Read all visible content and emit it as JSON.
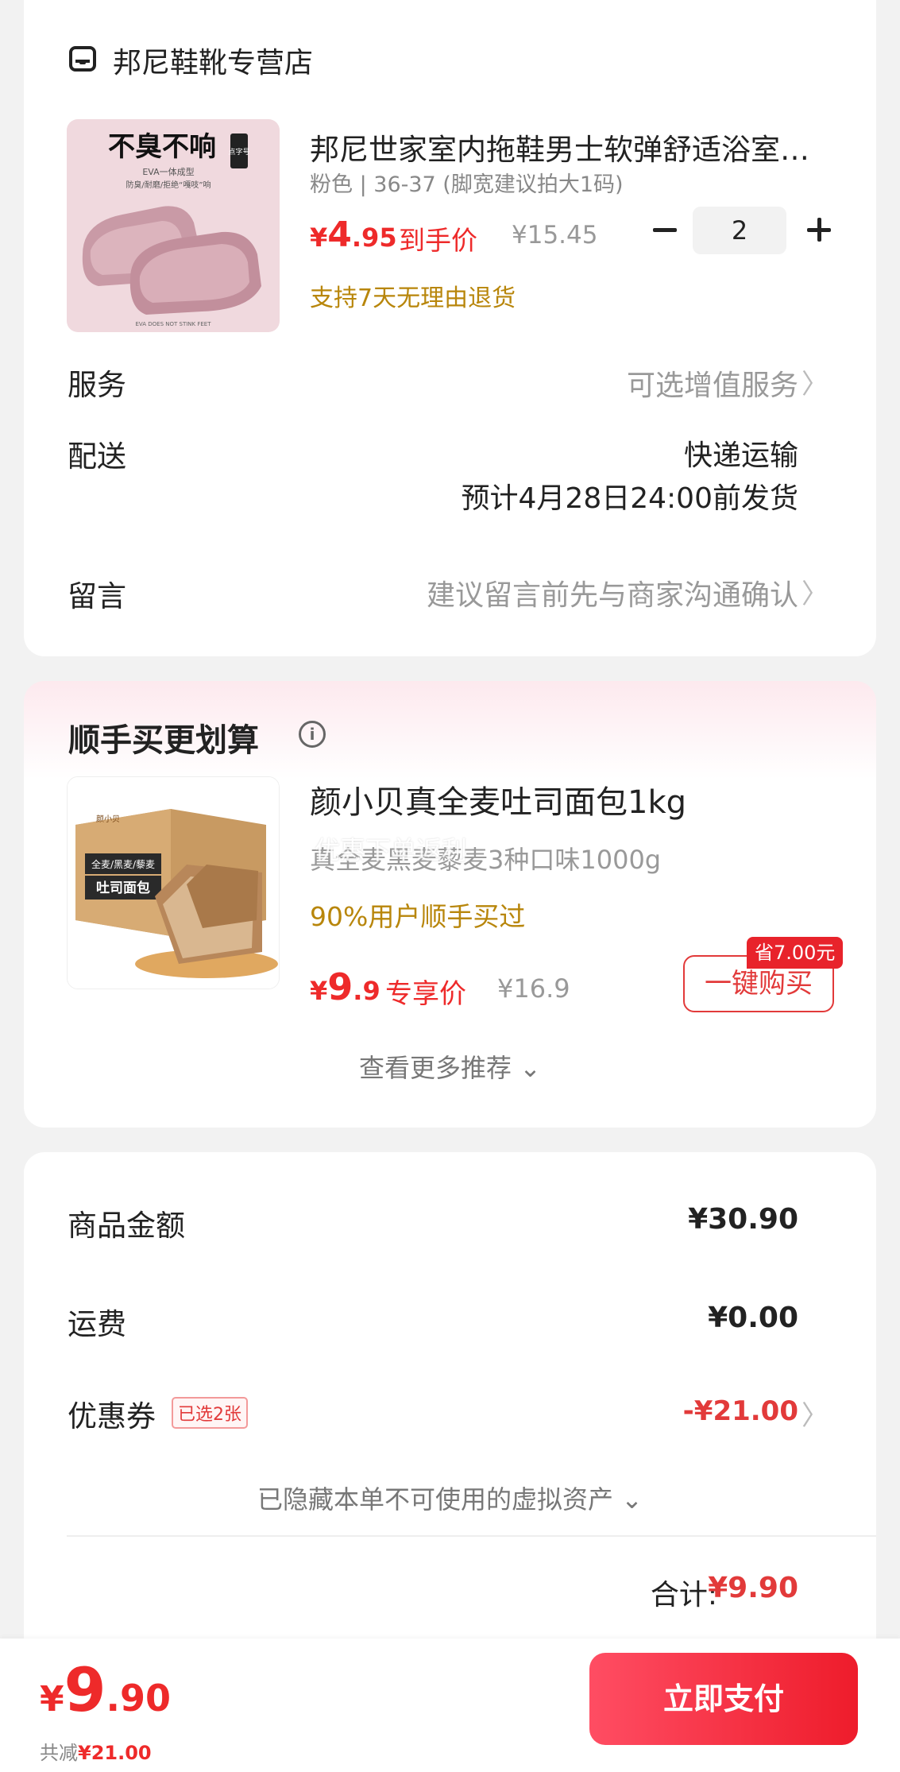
{
  "store": {
    "name": "邦尼鞋靴专营店",
    "icon": "store-icon"
  },
  "product": {
    "image_text_top": "不臭不响",
    "image_text_side": "点字号",
    "image_text_mid": "EVA一体成型",
    "image_text_sub": "防臭/耐磨/拒绝“嘎吱”响",
    "image_text_bottom": "EVA DOES NOT STINK FEET",
    "title": "邦尼世家室内拖鞋男士软弹舒适浴室…",
    "spec": "粉色 | 36-37 (脚宽建议拍大1码)",
    "price_currency": "¥",
    "price_int": "4",
    "price_dec": ".95",
    "price_tag": "到手价",
    "price_orig": "¥15.45",
    "quantity": "2",
    "return_policy": "支持7天无理由退货"
  },
  "service": {
    "label": "服务",
    "value": "可选增值服务"
  },
  "delivery": {
    "label": "配送",
    "method": "快递运输",
    "eta": "预计4月28日24:00前发货"
  },
  "message": {
    "label": "留言",
    "placeholder": "建议留言前先与商家沟通确认"
  },
  "chevron": "〉",
  "recommend": {
    "title": "顺手买更划算",
    "info_icon": "i",
    "image_text_a": "全麦/黑麦/藜麦",
    "image_text_b": "吐司面包",
    "image_brand": "颜小贝",
    "name": "颜小贝真全麦吐司面包1kg",
    "overlay_text": "优惠下单返利",
    "sub": "真全麦黑麦藜麦3种口味1000g",
    "social": "90%用户顺手买过",
    "price_currency": "¥",
    "price_int": "9",
    "price_dec": ".9",
    "price_tag": "专享价",
    "price_orig": "¥16.9",
    "save_badge": "省7.00元",
    "buy_label": "一键购买",
    "more_label": "查看更多推荐 ⌄"
  },
  "summary": {
    "goods_label": "商品金额",
    "goods_value": "¥30.90",
    "shipping_label": "运费",
    "shipping_value": "¥0.00",
    "coupon_label": "优惠券",
    "coupon_badge": "已选2张",
    "coupon_value": "-¥21.00",
    "hidden_assets": "已隐藏本单不可使用的虚拟资产 ⌄",
    "total_label": "合计:",
    "total_value": "¥9.90"
  },
  "bottom": {
    "price_currency": "¥",
    "price_int": "9",
    "price_dec": ".90",
    "save_prefix": "共减",
    "save_value": "¥21.00",
    "pay_label": "立即支付"
  },
  "colors": {
    "accent": "#ee2a2a",
    "gold": "#b8860b",
    "background": "#f2f2f2"
  }
}
